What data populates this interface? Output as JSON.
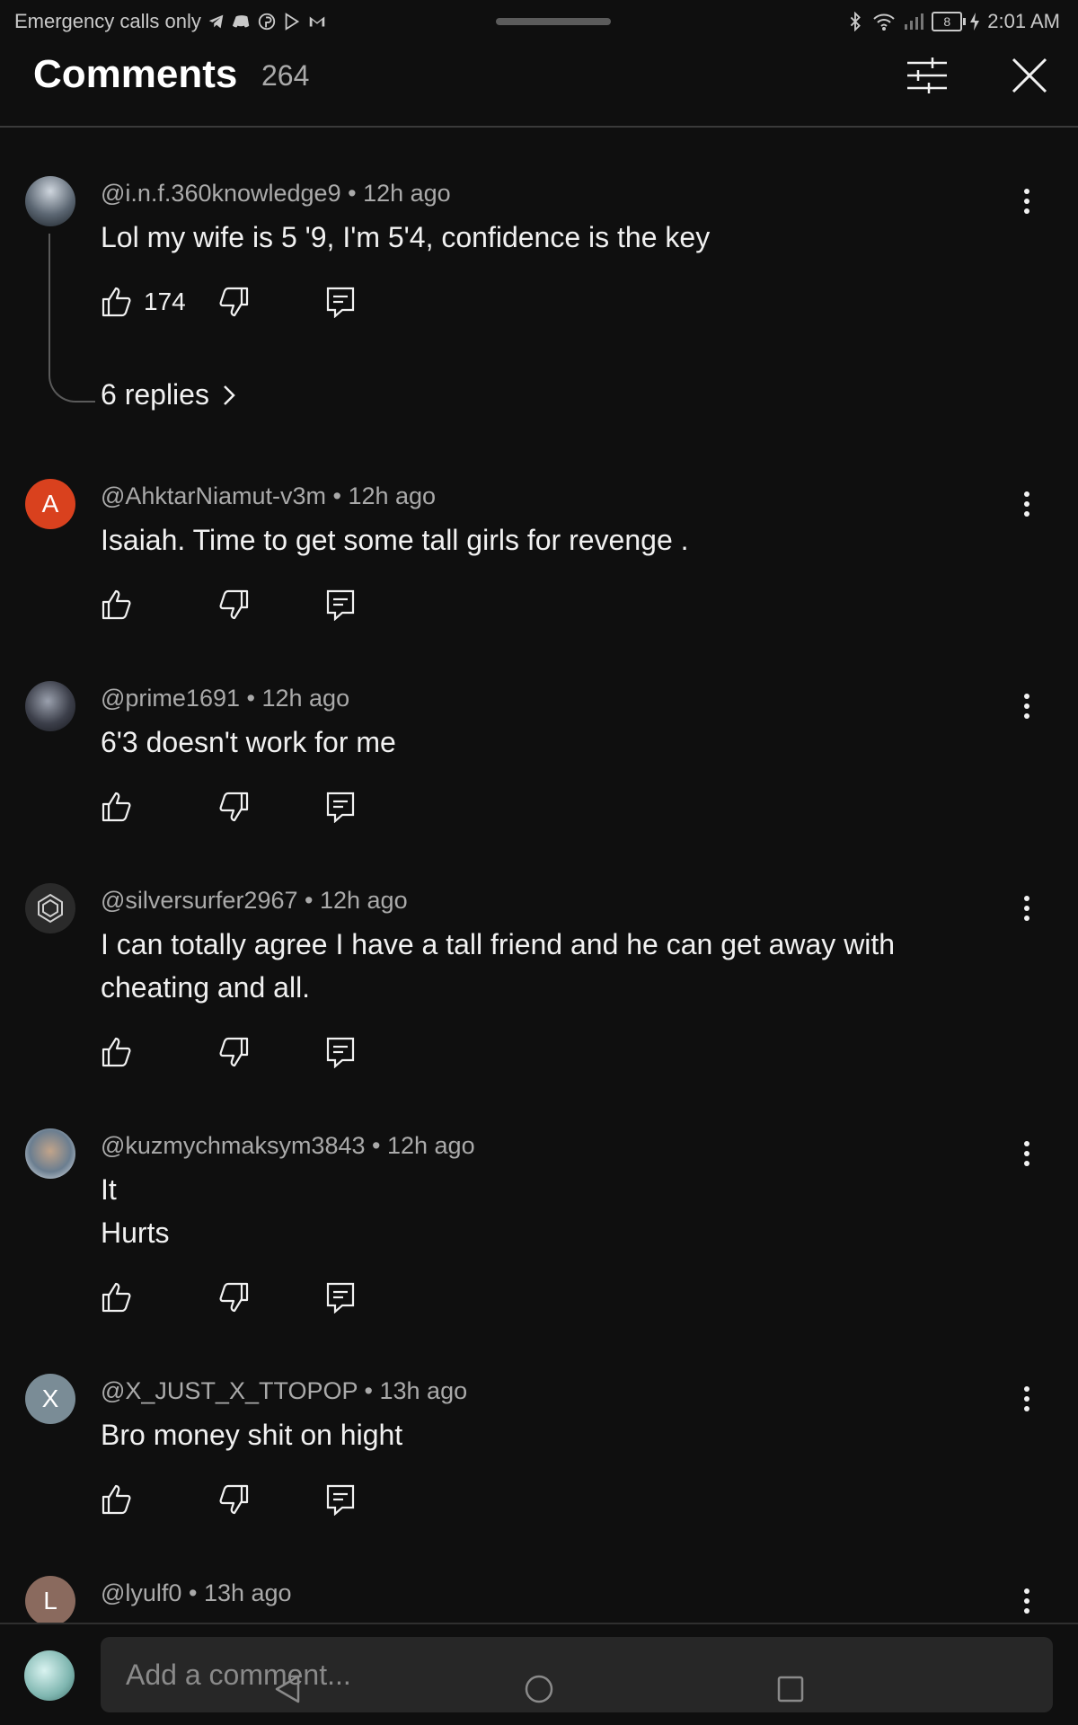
{
  "status_bar": {
    "left_text": "Emergency calls only",
    "battery": "8",
    "time": "2:01 AM"
  },
  "header": {
    "title": "Comments",
    "count": "264"
  },
  "comments": [
    {
      "avatar_letter": "",
      "avatar_color": "#4a5560",
      "author": "@i.n.f.360knowledge9",
      "time": "12h ago",
      "lines": [
        "Lol my wife is 5 '9, I'm 5'4, confidence is the key"
      ],
      "likes": "174",
      "replies": "6 replies"
    },
    {
      "avatar_letter": "A",
      "avatar_color": "#d9411e",
      "author": "@AhktarNiamut-v3m",
      "time": "12h ago",
      "lines": [
        "Isaiah. Time to get some tall girls for revenge ."
      ],
      "likes": ""
    },
    {
      "avatar_letter": "",
      "avatar_color": "#3c3f4a",
      "author": "@prime1691",
      "time": "12h ago",
      "lines": [
        "6'3 doesn't work for me"
      ],
      "likes": ""
    },
    {
      "avatar_letter": "",
      "avatar_color": "#2a2a2a",
      "author": "@silversurfer2967",
      "time": "12h ago",
      "lines": [
        "I can totally agree I have a tall friend and he can get away with",
        "cheating and all."
      ],
      "likes": ""
    },
    {
      "avatar_letter": "",
      "avatar_color": "#7a8a98",
      "author": "@kuzmychmaksym3843",
      "time": "12h ago",
      "lines": [
        "It",
        "Hurts"
      ],
      "likes": ""
    },
    {
      "avatar_letter": "X",
      "avatar_color": "#7a8c96",
      "author": "@X_JUST_X_TTOPOP",
      "time": "13h ago",
      "lines": [
        "Bro money shit on hight"
      ],
      "likes": ""
    },
    {
      "avatar_letter": "L",
      "avatar_color": "#8a6a5e",
      "author": "@lyulf0",
      "time": "13h ago",
      "lines": [],
      "likes": ""
    }
  ],
  "composer": {
    "placeholder": "Add a comment..."
  }
}
